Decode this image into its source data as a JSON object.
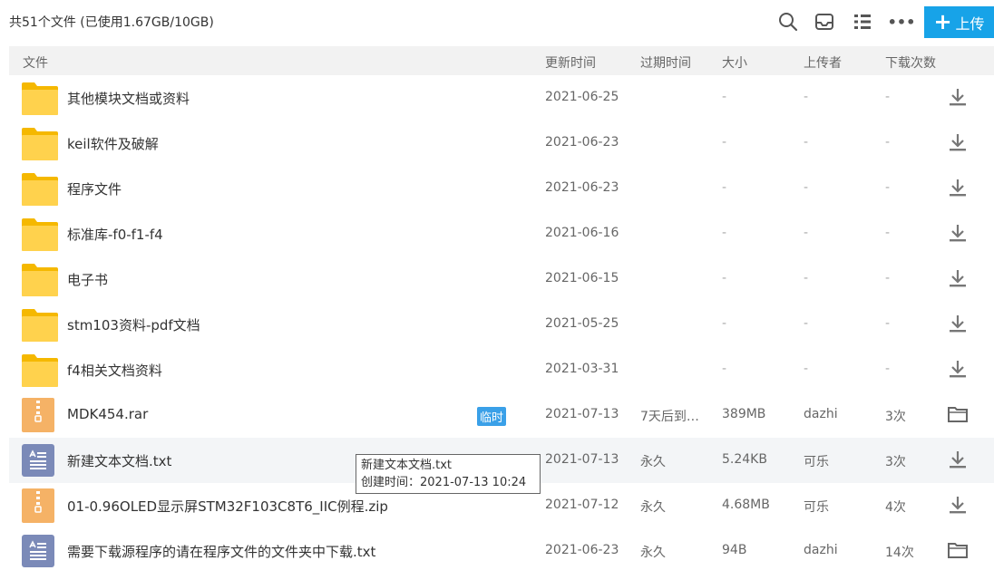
{
  "summary": "共51个文件 (已使用1.67GB/10GB)",
  "toolbar": {
    "search_icon": "search-icon",
    "inbox_icon": "inbox-icon",
    "list_icon": "list-view-icon",
    "more_label": "•••",
    "upload_label": "上传",
    "upload_plus": "+"
  },
  "columns": {
    "file": "文件",
    "updated": "更新时间",
    "expire": "过期时间",
    "size": "大小",
    "uploader": "上传者",
    "downloads": "下载次数"
  },
  "rows": [
    {
      "type": "folder",
      "name": "其他模块文档或资料",
      "date": "2021-06-25",
      "expire": "",
      "size": "-",
      "uploader": "-",
      "downloads": "-",
      "action": "download"
    },
    {
      "type": "folder",
      "name": "keil软件及破解",
      "date": "2021-06-23",
      "expire": "",
      "size": "-",
      "uploader": "-",
      "downloads": "-",
      "action": "download"
    },
    {
      "type": "folder",
      "name": "程序文件",
      "date": "2021-06-23",
      "expire": "",
      "size": "-",
      "uploader": "-",
      "downloads": "-",
      "action": "download"
    },
    {
      "type": "folder",
      "name": "标准库-f0-f1-f4",
      "date": "2021-06-16",
      "expire": "",
      "size": "-",
      "uploader": "-",
      "downloads": "-",
      "action": "download"
    },
    {
      "type": "folder",
      "name": "电子书",
      "date": "2021-06-15",
      "expire": "",
      "size": "-",
      "uploader": "-",
      "downloads": "-",
      "action": "download"
    },
    {
      "type": "folder",
      "name": "stm103资料-pdf文档",
      "date": "2021-05-25",
      "expire": "",
      "size": "-",
      "uploader": "-",
      "downloads": "-",
      "action": "download"
    },
    {
      "type": "folder",
      "name": "f4相关文档资料",
      "date": "2021-03-31",
      "expire": "",
      "size": "-",
      "uploader": "-",
      "downloads": "-",
      "action": "download"
    },
    {
      "type": "zip",
      "name": "MDK454.rar",
      "badge": "临时",
      "date": "2021-07-13",
      "expire": "7天后到…",
      "size": "389MB",
      "uploader": "dazhi",
      "downloads": "3次",
      "action": "open-folder"
    },
    {
      "type": "txt",
      "name": "新建文本文档.txt",
      "date": "2021-07-13",
      "expire": "永久",
      "size": "5.24KB",
      "uploader": "可乐",
      "downloads": "3次",
      "action": "download"
    },
    {
      "type": "zip",
      "name": "01-0.96OLED显示屏STM32F103C8T6_IIC例程.zip",
      "date": "2021-07-12",
      "expire": "永久",
      "size": "4.68MB",
      "uploader": "可乐",
      "downloads": "4次",
      "action": "download"
    },
    {
      "type": "txt",
      "name": "需要下载源程序的请在程序文件的文件夹中下载.txt",
      "date": "2021-06-23",
      "expire": "永久",
      "size": "94B",
      "uploader": "dazhi",
      "downloads": "14次",
      "action": "open-folder"
    }
  ],
  "tooltip": {
    "line1": "新建文本文档.txt",
    "line2": "创建时间：2021-07-13 10:24"
  },
  "colors": {
    "accent": "#17a3e8",
    "folder": "#ffd24d",
    "zip": "#f5b266",
    "txt": "#7b8ab8",
    "badge": "#3aa0e8"
  }
}
